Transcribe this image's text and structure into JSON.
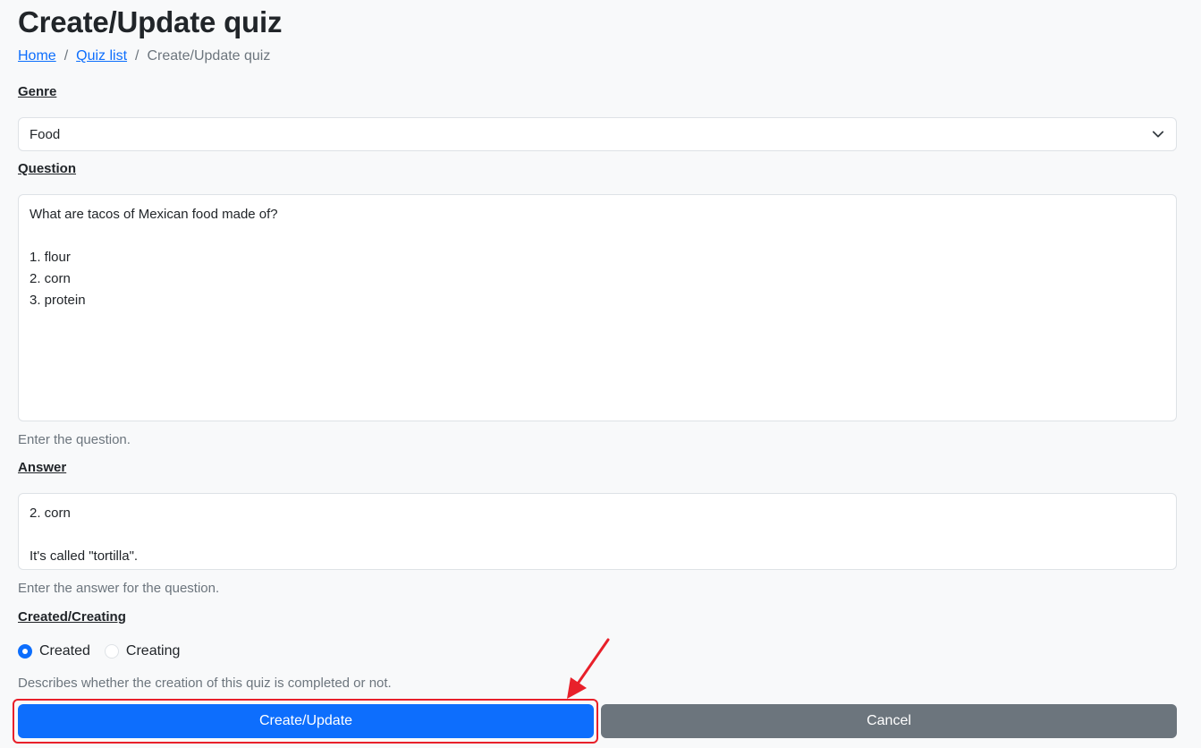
{
  "page": {
    "title": "Create/Update quiz"
  },
  "breadcrumb": {
    "home": "Home",
    "quiz_list": "Quiz list",
    "current": "Create/Update quiz",
    "separator": "/"
  },
  "genre": {
    "label": "Genre",
    "value": "Food"
  },
  "question": {
    "label": "Question",
    "lines": [
      "What are tacos of Mexican food made of?",
      "",
      "1. flour",
      "2. corn",
      "3. protein"
    ],
    "help": "Enter the question."
  },
  "answer": {
    "label": "Answer",
    "lines": [
      "2. corn",
      "",
      "It's called \"tortilla\"."
    ],
    "help": "Enter the answer for the question."
  },
  "status": {
    "label": "Created/Creating",
    "options": [
      {
        "label": "Created",
        "checked": true
      },
      {
        "label": "Creating",
        "checked": false
      }
    ],
    "help": "Describes whether the creation of this quiz is completed or not."
  },
  "buttons": {
    "submit": "Create/Update",
    "cancel": "Cancel"
  },
  "colors": {
    "primary": "#0d6efd",
    "secondary": "#6c757d",
    "annotation": "#e8202a"
  }
}
